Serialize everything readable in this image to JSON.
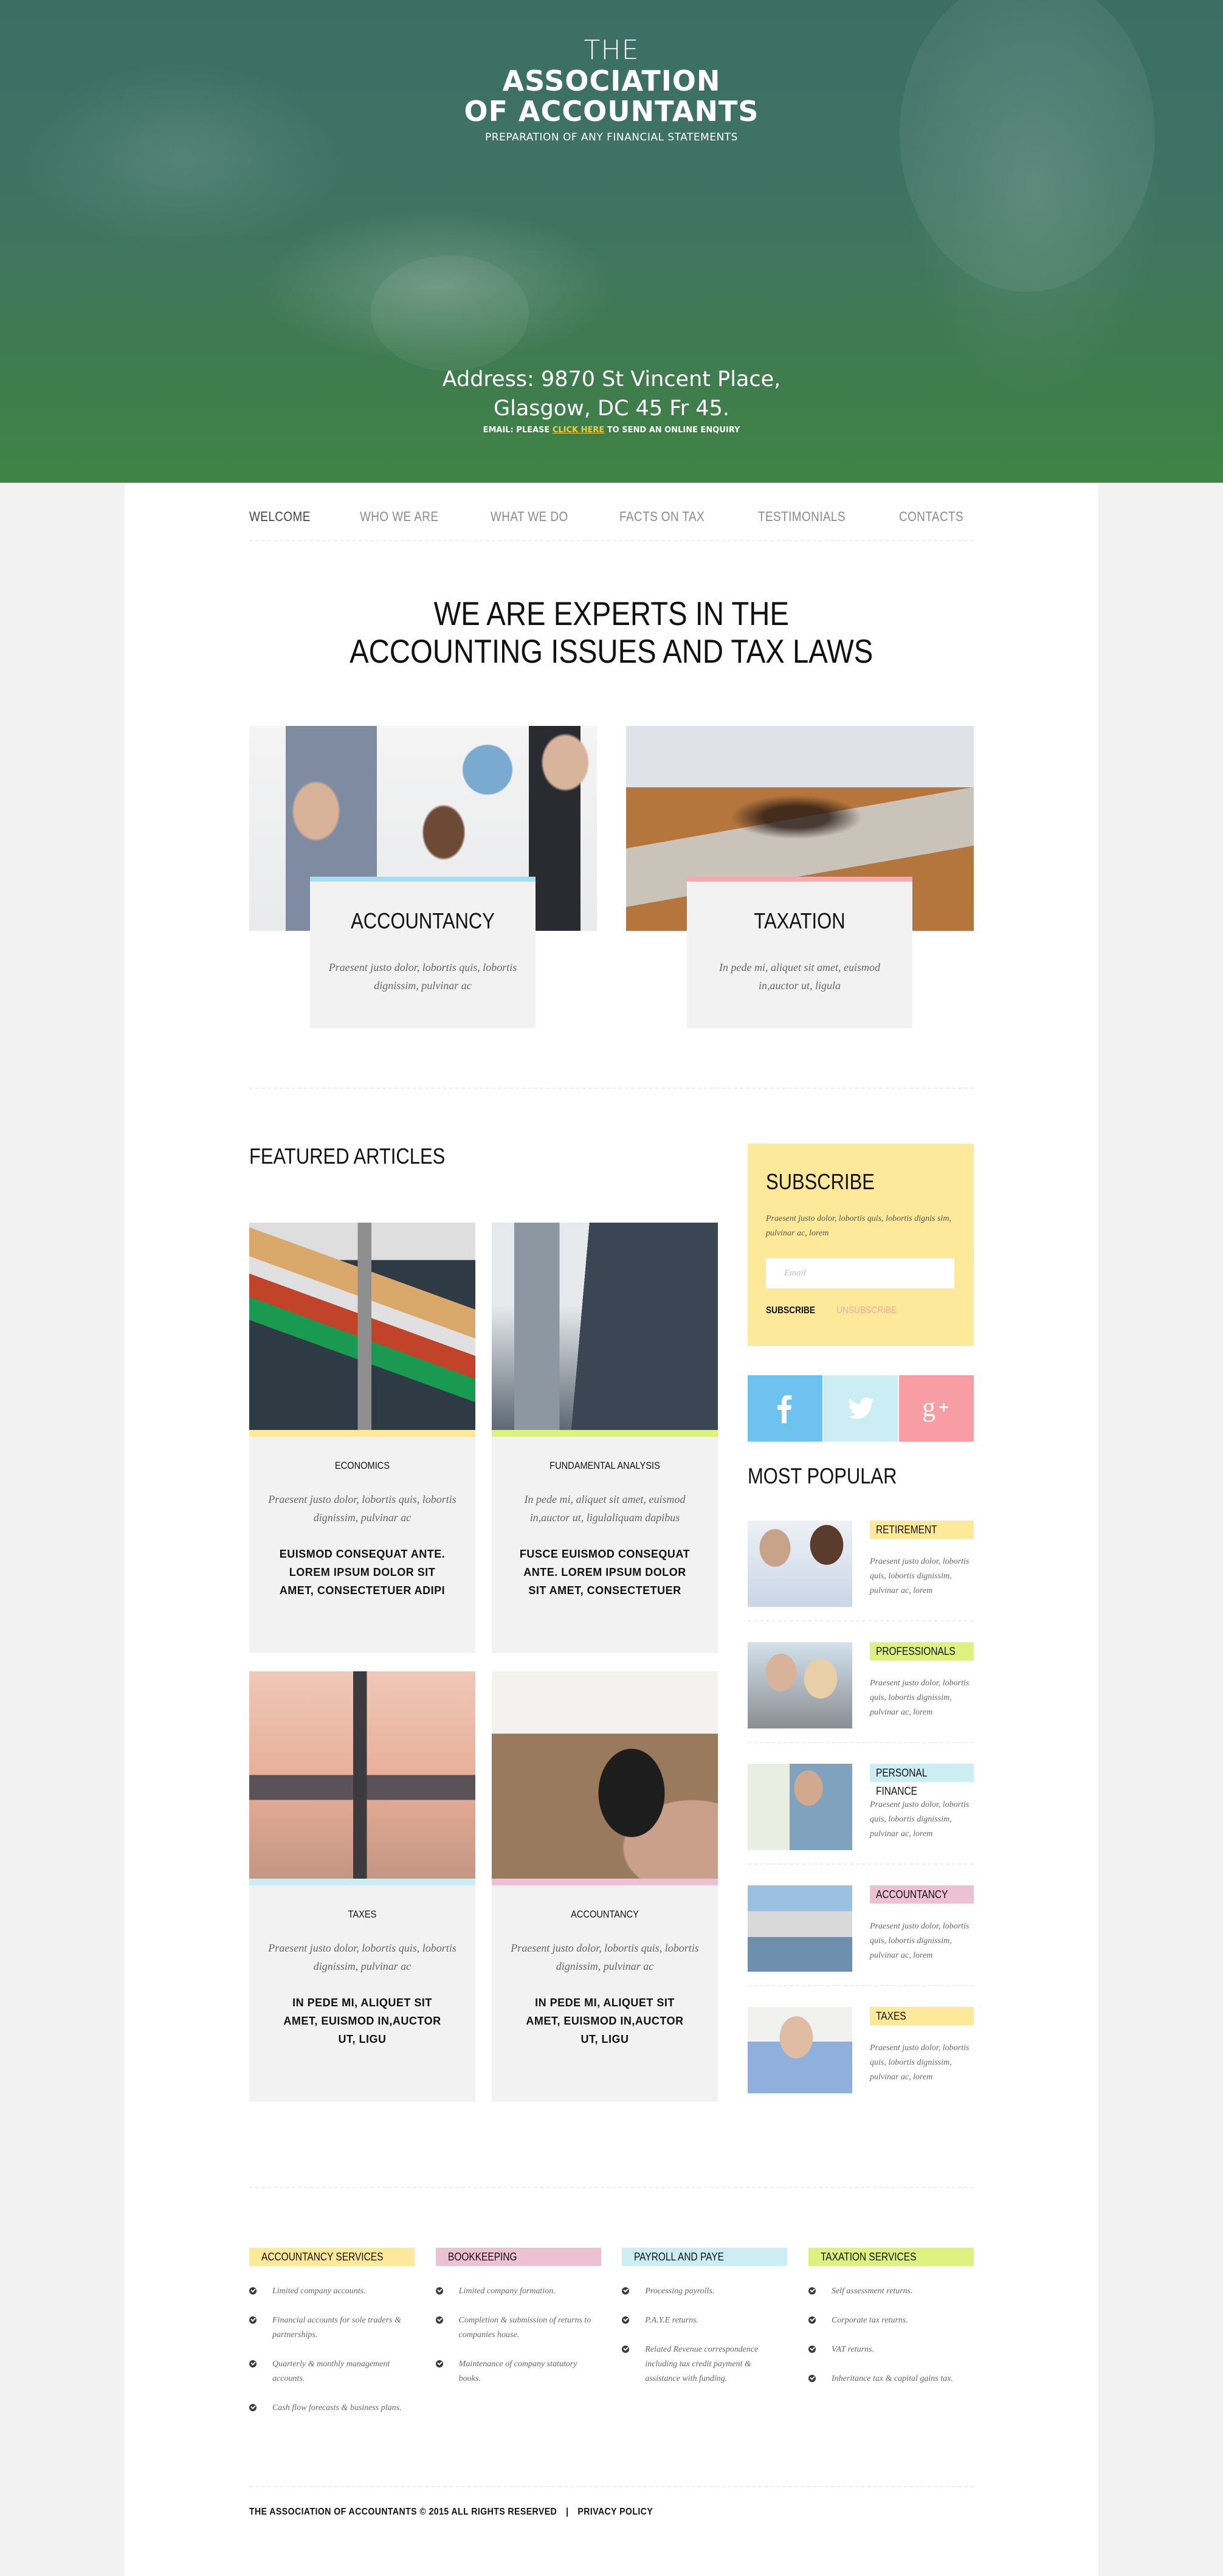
{
  "hero": {
    "the": "THE",
    "title_line1": "ASSOCIATION",
    "title_line2": "OF ACCOUNTANTS",
    "tagline": "PREPARATION OF ANY FINANCIAL STATEMENTS",
    "address_line1": "Address:  9870 St Vincent Place,",
    "address_line2": "Glasgow, DC 45 Fr 45.",
    "email_prefix": "EMAIL: PLEASE",
    "email_link": "CLICK HERE",
    "email_suffix": "TO SEND AN ONLINE ENQUIRY",
    "link_color": "#f5c842"
  },
  "nav": {
    "items": [
      {
        "label": "WELCOME",
        "active": true
      },
      {
        "label": "WHO WE ARE"
      },
      {
        "label": "WHAT WE DO"
      },
      {
        "label": "FACTS ON TAX"
      },
      {
        "label": "TESTIMONIALS"
      },
      {
        "label": "CONTACTS"
      }
    ]
  },
  "intro": {
    "title_line1": "WE ARE EXPERTS IN THE",
    "title_line2": "ACCOUNTING ISSUES AND TAX LAWS"
  },
  "services": [
    {
      "title": "ACCOUNTANCY",
      "text": "Praesent justo dolor, lobortis quis, lobortis dignissim, pulvinar ac",
      "color": "#a6dcf0"
    },
    {
      "title": "TAXATION",
      "text": "In pede mi, aliquet sit amet, euismod in,auctor ut, ligula",
      "color": "#f7a9ad"
    }
  ],
  "featured": {
    "heading": "FEATURED ARTICLES",
    "articles": [
      {
        "category": "ECONOMICS",
        "text": "Praesent justo dolor, lobortis quis, lobortis dignissim, pulvinar ac",
        "more": "EUISMOD CONSEQUAT ANTE. LOREM IPSUM DOLOR SIT AMET, CONSECTETUER ADIPI",
        "color": "#fee99b"
      },
      {
        "category": "FUNDAMENTAL ANALYSIS",
        "text": "In pede mi, aliquet sit amet, euismod in,auctor ut, ligulaliquam dapibus",
        "more": "FUSCE EUISMOD CONSEQUAT ANTE. LOREM IPSUM DOLOR SIT AMET, CONSECTETUER",
        "color": "#ddf180"
      },
      {
        "category": "TAXES",
        "text": "Praesent justo dolor, lobortis quis, lobortis dignissim, pulvinar ac",
        "more": "IN PEDE MI, ALIQUET SIT AMET, EUISMOD IN,AUCTOR UT, LIGU",
        "color": "#ccedf4"
      },
      {
        "category": "ACCOUNTANCY",
        "text": "Praesent justo dolor, lobortis quis, lobortis dignissim, pulvinar ac",
        "more": "IN PEDE MI, ALIQUET SIT AMET, EUISMOD IN,AUCTOR UT, LIGU",
        "color": "#ecc2d3"
      }
    ]
  },
  "subscribe": {
    "title": "SUBSCRIBE",
    "text": "Praesent justo dolor, lobortis quis, lobortis dignis sim, pulvinar ac, lorem",
    "email_placeholder": "Email",
    "email_value": "",
    "subscribe_label": "SUBSCRIBE",
    "unsubscribe_label": "UNSUBSCRIBE"
  },
  "social": [
    {
      "name": "facebook",
      "icon": "facebook-icon",
      "color": "#6ec2ef"
    },
    {
      "name": "twitter",
      "icon": "twitter-icon",
      "color": "#ccedf4"
    },
    {
      "name": "google-plus",
      "icon": "google-plus-icon",
      "color": "#f99da5"
    }
  ],
  "popular": {
    "heading": "MOST POPULAR",
    "items": [
      {
        "tag": "RETIREMENT",
        "text": "Praesent justo dolor, lobortis quis, lobortis dignissim, pulvinar ac, lorem",
        "color": "#fee99b"
      },
      {
        "tag": "PROFESSIONALS",
        "text": "Praesent justo dolor, lobortis quis, lobortis dignissim, pulvinar ac, lorem",
        "color": "#ddf180"
      },
      {
        "tag": "PERSONAL FINANCE",
        "text": "Praesent justo dolor, lobortis quis, lobortis dignissim, pulvinar ac, lorem",
        "color": "#ccedf4"
      },
      {
        "tag": "ACCOUNTANCY",
        "text": "Praesent justo dolor, lobortis quis, lobortis dignissim, pulvinar ac, lorem",
        "color": "#ecc2d3"
      },
      {
        "tag": "TAXES",
        "text": "Praesent justo dolor, lobortis quis, lobortis dignissim, pulvinar ac, lorem",
        "color": "#fee99b"
      }
    ]
  },
  "footer_services": [
    {
      "title": "ACCOUNTANCY SERVICES",
      "color": "#fee99b",
      "items": [
        "Limited company accounts.",
        "Financial accounts for sole traders & partnerships.",
        "Quarterly & monthly management accounts.",
        "Cash flow forecasts & business plans."
      ]
    },
    {
      "title": "BOOKKEEPING",
      "color": "#ecc2d3",
      "items": [
        "Limited company formation.",
        "Completion & submission of returns to companies house.",
        "Maintenance of company statutory books."
      ]
    },
    {
      "title": "PAYROLL AND PAYE",
      "color": "#ccedf4",
      "items": [
        "Processing payrolls.",
        "P.A.Y.E returns.",
        "Related Revenue correspondence including tax credit payment & assistance with funding."
      ]
    },
    {
      "title": "TAXATION SERVICES",
      "color": "#ddf180",
      "items": [
        "Self assessment returns.",
        "Corporate tax returns.",
        "VAT returns.",
        "Inheritance tax & capital gains tax."
      ]
    }
  ],
  "copyright": {
    "text": "THE ASSOCIATION OF ACCOUNTANTS  © 2015 ALL RIGHTS RESERVED",
    "separator": "|",
    "privacy": "PRIVACY POLICY"
  }
}
